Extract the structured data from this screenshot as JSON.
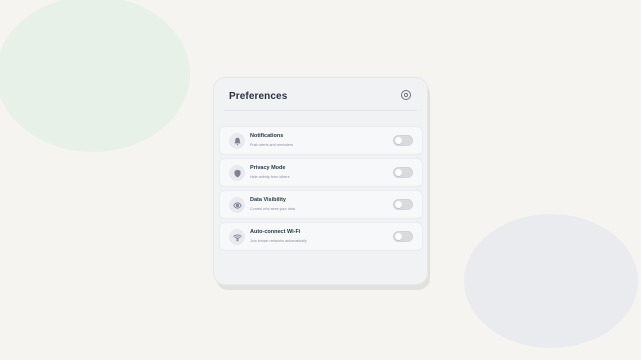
{
  "panel": {
    "title": "Preferences",
    "header_icon": "gear-icon"
  },
  "settings": [
    {
      "label": "Notifications",
      "description": "Push alerts and reminders",
      "icon": "bell-icon",
      "enabled": false
    },
    {
      "label": "Privacy Mode",
      "description": "Hide activity from others",
      "icon": "shield-icon",
      "enabled": false
    },
    {
      "label": "Data Visibility",
      "description": "Control who sees your data",
      "icon": "eye-icon",
      "enabled": false
    },
    {
      "label": "Auto-connect Wi-Fi",
      "description": "Join known networks automatically",
      "icon": "wifi-icon",
      "enabled": false
    }
  ],
  "colors": {
    "background": "#f5f4f0",
    "card": "#f1f2f4",
    "title_text": "#2a3140",
    "toggle_off": "#d9dbdf",
    "accent_blob_green": "#e8f1e8",
    "accent_blob_blue": "#e9ebef"
  }
}
